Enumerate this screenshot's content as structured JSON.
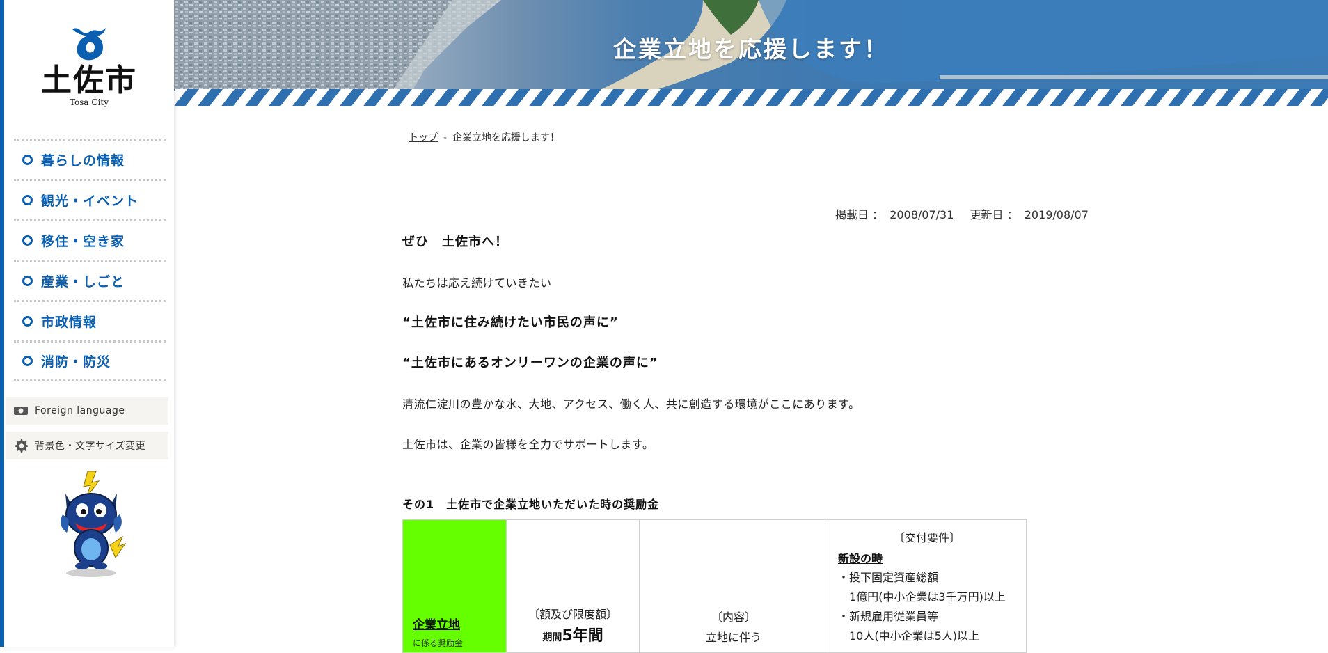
{
  "site": {
    "logo_text": "土佐市",
    "logo_sub": "Tosa City"
  },
  "nav": {
    "items": [
      {
        "label": "暮らしの情報"
      },
      {
        "label": "観光・イベント"
      },
      {
        "label": "移住・空き家"
      },
      {
        "label": "産業・しごと"
      },
      {
        "label": "市政情報"
      },
      {
        "label": "消防・防災"
      }
    ]
  },
  "utility": {
    "foreign_language": "Foreign language",
    "display_settings": "背景色・文字サイズ変更"
  },
  "banner": {
    "title": "企業立地を応援します！"
  },
  "breadcrumb": {
    "home": "トップ",
    "separator": "-",
    "current": "企業立地を応援します！"
  },
  "dates": {
    "posted_label": "掲載日 ：",
    "posted_value": "2008/07/31",
    "updated_label": "更新日 ：",
    "updated_value": "2019/08/07"
  },
  "content": {
    "heading": "ぜひ　土佐市へ！",
    "p1": "私たちは応え続けていきたい",
    "quote1": "“土佐市に住み続けたい市民の声に”",
    "quote2": "“土佐市にあるオンリーワンの企業の声に”",
    "p2": "清流仁淀川の豊かな水、大地、アクセス、働く人、共に創造する環境がここにあります。",
    "p3": "土佐市は、企業の皆様を全力でサポートします。",
    "section1_heading": "その1　土佐市で企業立地いただいた時の奨励金"
  },
  "grant_table": {
    "title": "企業立地",
    "subtitle": "に係る奨励金",
    "amount_label": "〔額及び限度額〕",
    "amount_prefix": "期間",
    "amount_value": "5年間",
    "content_label": "〔内容〕",
    "content_sub": "立地に伴う",
    "requirements_label": "〔交付要件〕",
    "req_new": "新設の時",
    "req_line1": "・投下固定資産総額",
    "req_line2": "1億円(中小企業は3千万円)以上",
    "req_line3": "・新規雇用従業員等",
    "req_line4": "10人(中小企業は5人)以上"
  },
  "colors": {
    "brand_blue": "#0a5fb0",
    "highlight_green": "#66ff00"
  }
}
